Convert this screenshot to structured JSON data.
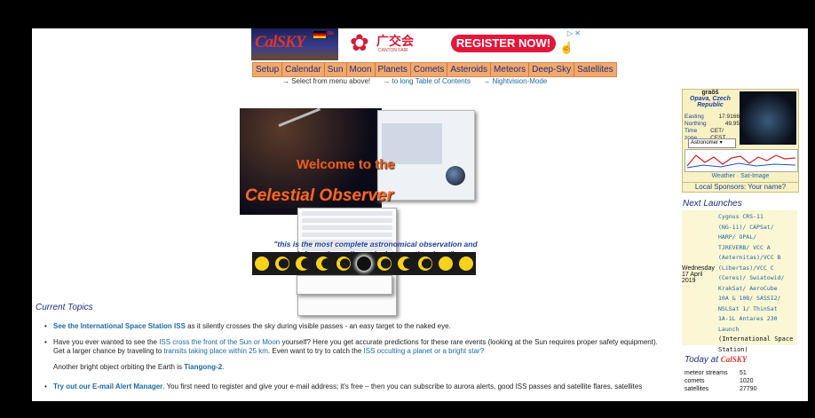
{
  "header": {
    "logo_text": "Cal",
    "logo_text2": "SKY",
    "logo_lang": "de",
    "ad": {
      "cn_title": "广交会",
      "sub": "CANTON FAIR",
      "button": "REGISTER NOW!"
    }
  },
  "menu": [
    "Setup",
    "Calendar",
    "Sun",
    "Moon",
    "Planets",
    "Comets",
    "Asteroids",
    "Meteors",
    "Deep-Sky",
    "Satellites"
  ],
  "sub_links": {
    "select_text": "→ Select from menu above!",
    "toc_link": "→ to long Table of Contents",
    "night_link": "→ Nightvision-Mode"
  },
  "collage": {
    "welcome": "Welcome to the",
    "title": "Celestial Observer",
    "quote": "\"this is the most complete astronomical observation and information online-calculator on the planet\""
  },
  "location": {
    "name": "graôš",
    "place": "Opava, Czech Republic",
    "rows": [
      {
        "k": "Easting",
        "v": "17.9166"
      },
      {
        "k": "Northing",
        "v": "49.95"
      },
      {
        "k": "Time zone",
        "v": "CET/ CEST"
      }
    ],
    "select": "Astronomer",
    "weather_links": "Weather · Sat-Image",
    "sponsors": "Local Sponsors: Your name?"
  },
  "launches": {
    "title": "Next Launches",
    "date": "Wednesday 17 April 2019",
    "items": [
      "Cygnus CRS-11",
      "(NG-11)/ CAPSat/",
      "HARP/ OPAL/",
      "TJREVERB/ VCC A",
      "(Aeternitas)/VCC B",
      "(Libertas)/VCC C",
      "(Ceres)/ Swiatowid/",
      "KrakSat/ AeroCube",
      "10A & 10B/ SASSI2/",
      "NSLSat 1/ ThinSat",
      "1A-1L Antares 230",
      "Launch"
    ],
    "note": "(International Space Station)"
  },
  "today": {
    "title": "Today at",
    "rows": [
      {
        "k": "meteor streams",
        "v": "51"
      },
      {
        "k": "comets",
        "v": "1020"
      },
      {
        "k": "satellites",
        "v": "27790"
      }
    ]
  },
  "topics": {
    "title": "Current Topics",
    "t1_link": "See the International Space Station ISS",
    "t1_rest": " as it silently crosses the sky during visible passes - an easy target to the naked eye.",
    "t2_a": "Have you ever wanted to see the ",
    "t2_link1": "ISS cross the front of the Sun or Moon",
    "t2_b": " yourself? Here you get accurate predictions for these rare events (looking at the Sun requires proper safety equipment). Get a larger chance by traveling to ",
    "t2_link2": "transits taking place within 25 km",
    "t2_c": ". Even want to try to catch the ",
    "t2_link3": "ISS occulting a planet or a bright star?",
    "t3_a": "Another bright object orbiting the Earth is ",
    "t3_link": "Tiangong-2",
    "t3_b": ".",
    "t4_link": "Try out our E-mail Alert Manager",
    "t4_rest": ". You first need to register and give your e-mail address; it's free – then you can subscribe to aurora alerts, good ISS passes and satellite flares, satellites"
  }
}
